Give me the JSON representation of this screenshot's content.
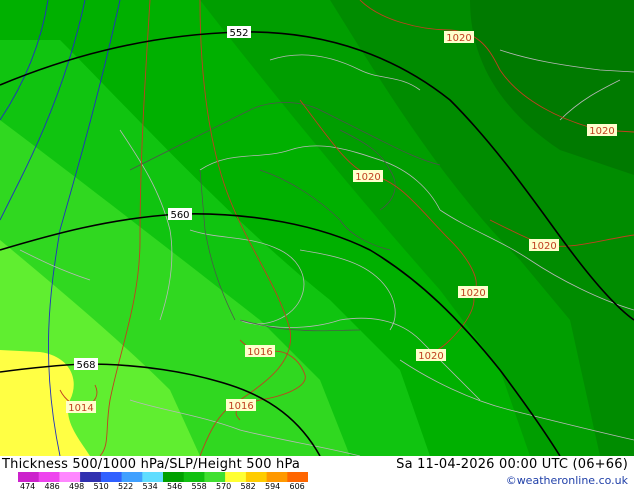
{
  "footer": {
    "title": "Thickness 500/1000 hPa/SLP/Height 500 hPa",
    "datetime": "Sa 11-04-2026 00:00 UTC (06+66)",
    "credit": "©weatheronline.co.uk"
  },
  "legend": {
    "ticks": [
      "474",
      "486",
      "498",
      "510",
      "522",
      "534",
      "546",
      "558",
      "570",
      "582",
      "594",
      "606"
    ],
    "colors": [
      "#cc22cc",
      "#ee44ee",
      "#ff88ff",
      "#3030b0",
      "#3060ff",
      "#40a0ff",
      "#60ddff",
      "#00a000",
      "#10c010",
      "#40e030",
      "#ffff33",
      "#ffcc00",
      "#ff9900",
      "#ff6600"
    ]
  },
  "height_labels": [
    "552",
    "560",
    "568"
  ],
  "pressure_labels": [
    "1020",
    "1020",
    "1020",
    "1020",
    "1020",
    "1020",
    "1016",
    "1016",
    "1014"
  ],
  "colors": {
    "height_contour": "#000000",
    "isobar": "#c04020",
    "thickness_line": "#2030c0",
    "border": "#b0b0b0",
    "label_bg": "#ffffcc"
  }
}
